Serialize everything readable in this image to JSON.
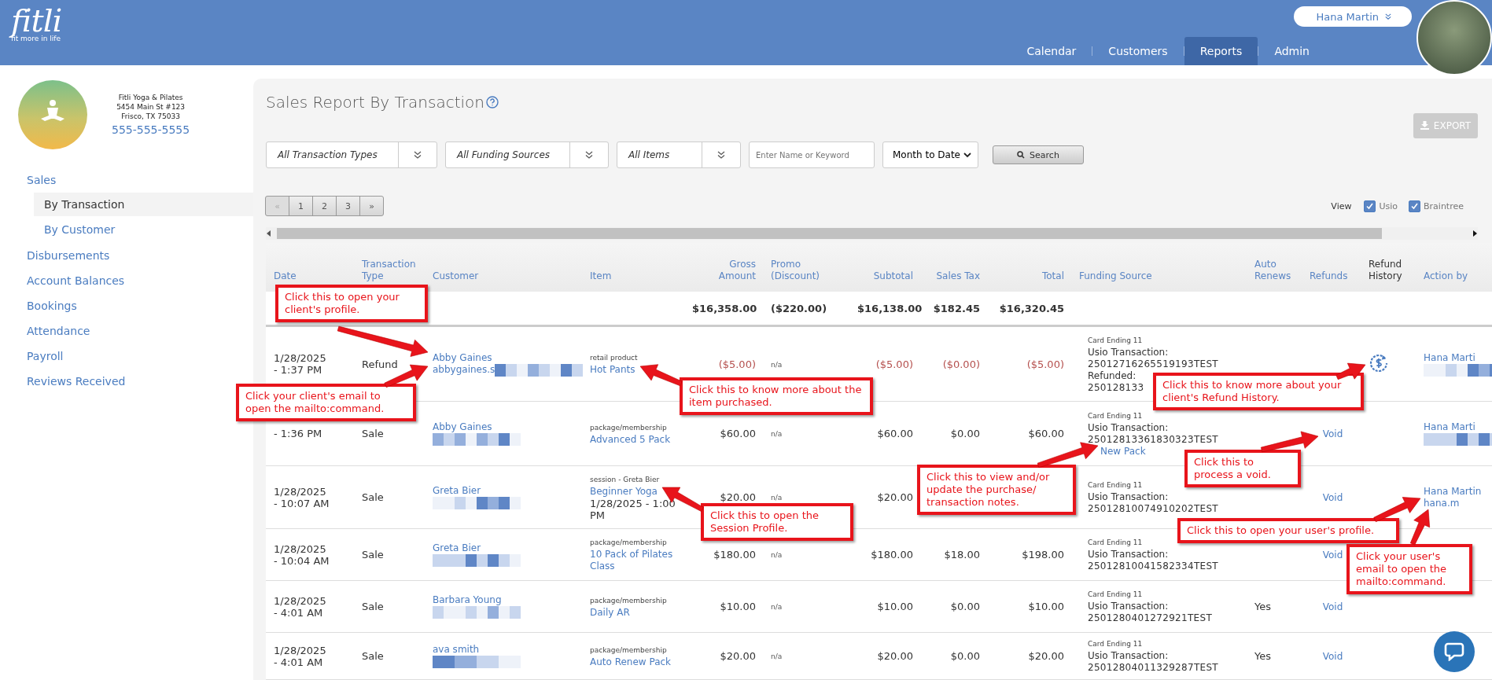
{
  "header": {
    "logo": "fitli",
    "tagline": "fit more in life",
    "user_menu": "Hana Martin",
    "nav_tabs": [
      {
        "label": "Calendar",
        "selected": false
      },
      {
        "label": "Customers",
        "selected": false
      },
      {
        "label": "Reports",
        "selected": true
      },
      {
        "label": "Admin",
        "selected": false
      }
    ]
  },
  "sidebar": {
    "business": {
      "name": "Fitli Yoga & Pilates",
      "address_line_1": "5454 Main St #123",
      "address_line_2": "Frisco, TX 75033",
      "phone": "555-555-5555"
    },
    "nav": [
      {
        "label": "Sales",
        "selected": false,
        "children": [
          {
            "label": "By Transaction",
            "selected": true
          },
          {
            "label": "By Customer",
            "selected": false
          }
        ]
      },
      {
        "label": "Disbursements",
        "selected": false
      },
      {
        "label": "Account Balances",
        "selected": false
      },
      {
        "label": "Bookings",
        "selected": false
      },
      {
        "label": "Attendance",
        "selected": false
      },
      {
        "label": "Payroll",
        "selected": false
      },
      {
        "label": "Reviews Received",
        "selected": false
      }
    ]
  },
  "report": {
    "title": "Sales Report By Transaction",
    "filters": [
      {
        "kind": "dropdown",
        "value": "All Transaction Types"
      },
      {
        "kind": "dropdown",
        "value": "All Funding Sources"
      },
      {
        "kind": "dropdown",
        "value": "All Items"
      },
      {
        "kind": "input",
        "placeholder": "Enter Name or Keyword"
      },
      {
        "kind": "select",
        "value": "Month to Date"
      }
    ],
    "search_button": "Search",
    "export_button": {
      "label": "EXPORT",
      "disabled": true
    },
    "pagination": [
      {
        "label": "«",
        "disabled": true
      },
      {
        "label": "1",
        "disabled": false
      },
      {
        "label": "2",
        "disabled": false
      },
      {
        "label": "3",
        "disabled": false
      },
      {
        "label": "»",
        "disabled": false
      }
    ],
    "view": {
      "label": "View",
      "options": [
        {
          "label": "Usio",
          "checked": true
        },
        {
          "label": "Braintree",
          "checked": true
        }
      ]
    },
    "table": {
      "columns": [
        "Date",
        "Transaction Type",
        "Customer",
        "Item",
        "Gross Amount",
        "Promo (Discount)",
        "Subtotal",
        "Sales Tax",
        "Total",
        "Funding Source",
        "Auto Renews",
        "Refunds",
        "Refund History",
        "Action by"
      ],
      "totals": {
        "gross": "$16,358.00",
        "promo": "($220.00)",
        "subtotal": "$16,138.00",
        "sales_tax": "$182.45",
        "total": "$16,320.45"
      },
      "rows": [
        {
          "date": "1/28/2025",
          "time": "- 1:37 PM",
          "type": "Refund",
          "customer": "Abby Gaines",
          "email": "abbygaines.s",
          "customer_redacted": true,
          "item_category": "retail product",
          "item": "Hot Pants",
          "gross": "($5.00)",
          "promo": "n/a",
          "subtotal": "($5.00)",
          "sales_tax": "($0.00)",
          "total": "($5.00)",
          "negative": true,
          "funding": {
            "card": "Card Ending 11",
            "label": "Usio Transaction:",
            "id": "25012716265519193TEST",
            "refunded_label": "Refunded:",
            "refunded_id": "250128133"
          },
          "refund_history": true,
          "action_by": "Hana Marti",
          "action_by_redacted": true
        },
        {
          "time": "- 1:36 PM",
          "type": "Sale",
          "customer": "Abby Gaines",
          "customer_redacted": true,
          "item_category": "package/membership",
          "item": "Advanced 5 Pack",
          "gross": "$60.00",
          "promo": "n/a",
          "subtotal": "$60.00",
          "sales_tax": "$0.00",
          "total": "$60.00",
          "negative": false,
          "funding": {
            "card": "Card Ending 11",
            "label": "Usio Transaction:",
            "id": "25012813361830323TEST",
            "note": "New Pack"
          },
          "refunds": "Void",
          "refund_history": false,
          "action_by": "Hana Marti",
          "action_by_redacted": true
        },
        {
          "date": "1/28/2025",
          "time": "- 10:07 AM",
          "type": "Sale",
          "customer": "Greta Bier",
          "customer_redacted": true,
          "item_category": "session - Greta Bier",
          "item": "Beginner Yoga",
          "item_detail": "1/28/2025 - 1:00 PM",
          "gross": "$20.00",
          "promo": "n/a",
          "subtotal": "$20.00",
          "negative": false,
          "funding": {
            "card": "Card Ending 11",
            "label": "Usio Transaction:",
            "id": "25012810074910202TEST"
          },
          "refunds": "Void",
          "refund_history": false,
          "action_by": "Hana Martin",
          "action_by_email": "hana.m",
          "action_by_redacted": false
        },
        {
          "date": "1/28/2025",
          "time": "- 10:04 AM",
          "type": "Sale",
          "customer": "Greta Bier",
          "customer_redacted": true,
          "item_category": "package/membership",
          "item": "10 Pack of Pilates Class",
          "gross": "$180.00",
          "promo": "n/a",
          "subtotal": "$180.00",
          "sales_tax": "$18.00",
          "total": "$198.00",
          "negative": false,
          "funding": {
            "card": "Card Ending 11",
            "label": "Usio Transaction:",
            "id": "25012810041582334TEST"
          },
          "refunds": "Void",
          "refund_history": false,
          "action_by_redacted": false
        },
        {
          "date": "1/28/2025",
          "time": "- 4:01 AM",
          "type": "Sale",
          "customer": "Barbara Young",
          "customer_redacted": true,
          "item_category": "package/membership",
          "item": "Daily AR",
          "gross": "$10.00",
          "promo": "n/a",
          "subtotal": "$10.00",
          "sales_tax": "$0.00",
          "total": "$10.00",
          "negative": false,
          "funding": {
            "card": "Card Ending 11",
            "label": "Usio Transaction:",
            "id": "2501280401272921TEST"
          },
          "auto_renews": "Yes",
          "refunds": "Void",
          "refund_history": false,
          "action_by_redacted": false
        },
        {
          "date": "1/28/2025",
          "time": "- 4:01 AM",
          "type": "Sale",
          "customer": "ava smith",
          "customer_redacted": true,
          "item_category": "package/membership",
          "item": "Auto Renew Pack",
          "gross": "$20.00",
          "promo": "n/a",
          "subtotal": "$20.00",
          "sales_tax": "$0.00",
          "total": "$20.00",
          "negative": false,
          "funding": {
            "card": "Card Ending 11",
            "label": "Usio Transaction:",
            "id": "25012804011329287TEST"
          },
          "auto_renews": "Yes",
          "refunds": "Void",
          "refund_history": false,
          "action_by_redacted": false
        }
      ]
    }
  },
  "callouts": [
    "Click this to open your client's profile.",
    "Click your client's email to open the mailto:command.",
    "Click this to know more about the item purchased.",
    "Click this to open the Session Profile.",
    "Click this to view and/or update the purchase/ transaction notes.",
    "Click this to know more about your client's Refund History.",
    "Click this to process a void.",
    "Click this to open your user's profile.",
    "Click your user's email to open the mailto:command."
  ]
}
